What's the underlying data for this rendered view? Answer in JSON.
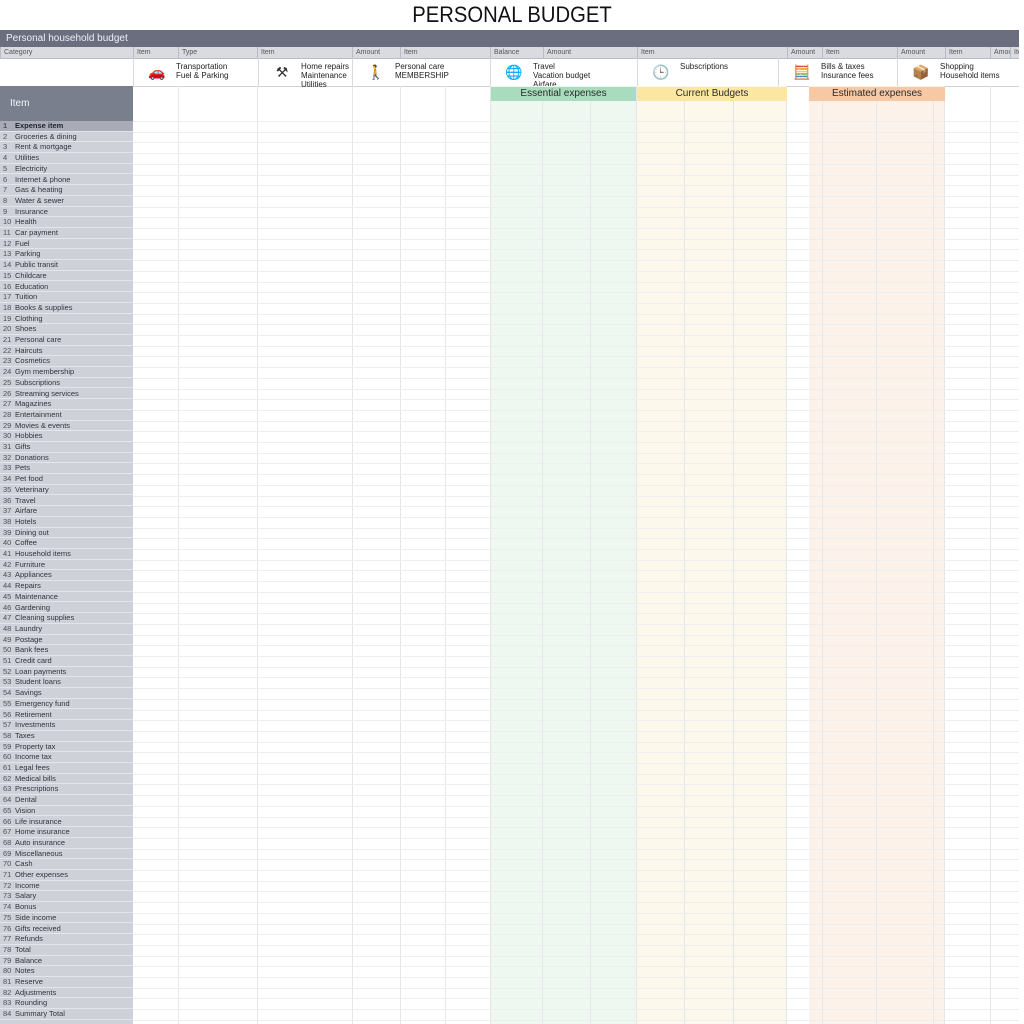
{
  "title": "PERSONAL BUDGET",
  "topbar_label": "Personal household budget",
  "column_headers": [
    "Category",
    "Item",
    "Type",
    "Item",
    "Amount",
    "Item",
    "Balance",
    "Amount",
    "Item",
    "Amount",
    "Item",
    "Amount",
    "Item",
    "Amount",
    "Item"
  ],
  "categories": [
    {
      "icon": "car-icon",
      "glyph": "🚗",
      "label": "Transportation\nFuel & Parking"
    },
    {
      "icon": "tools-icon",
      "glyph": "⚒",
      "label": "Home repairs\nMaintenance\nUtilities"
    },
    {
      "icon": "person-icon",
      "glyph": "🚶",
      "label": "Personal care\nMEMBERSHIP"
    },
    {
      "icon": "globe-icon",
      "glyph": "🌐",
      "label": "Travel\nVacation budget\nAirfare"
    },
    {
      "icon": "clock-icon",
      "glyph": "🕒",
      "label": "Subscriptions"
    },
    {
      "icon": "calculator-icon",
      "glyph": "🧮",
      "label": "Bills & taxes\nInsurance fees"
    },
    {
      "icon": "box-icon",
      "glyph": "📦",
      "label": "Shopping\nHousehold items"
    }
  ],
  "side_header": "Item",
  "sections": {
    "green": "Essential expenses",
    "yellow": "Current Budgets",
    "orange": "Estimated expenses"
  },
  "sidebar_items": [
    "Expense item",
    "Groceries & dining",
    "Rent & mortgage",
    "Utilities",
    "Electricity",
    "Internet & phone",
    "Gas & heating",
    "Water & sewer",
    "Insurance",
    "Health",
    "Car payment",
    "Fuel",
    "Parking",
    "Public transit",
    "Childcare",
    "Education",
    "Tuition",
    "Books & supplies",
    "Clothing",
    "Shoes",
    "Personal care",
    "Haircuts",
    "Cosmetics",
    "Gym membership",
    "Subscriptions",
    "Streaming services",
    "Magazines",
    "Entertainment",
    "Movies & events",
    "Hobbies",
    "Gifts",
    "Donations",
    "Pets",
    "Pet food",
    "Veterinary",
    "Travel",
    "Airfare",
    "Hotels",
    "Dining out",
    "Coffee",
    "Household items",
    "Furniture",
    "Appliances",
    "Repairs",
    "Maintenance",
    "Gardening",
    "Cleaning supplies",
    "Laundry",
    "Postage",
    "Bank fees",
    "Credit card",
    "Loan payments",
    "Student loans",
    "Savings",
    "Emergency fund",
    "Retirement",
    "Investments",
    "Taxes",
    "Property tax",
    "Income tax",
    "Legal fees",
    "Medical bills",
    "Prescriptions",
    "Dental",
    "Vision",
    "Life insurance",
    "Home insurance",
    "Auto insurance",
    "Miscellaneous",
    "Cash",
    "Other expenses",
    "Income",
    "Salary",
    "Bonus",
    "Side income",
    "Gifts received",
    "Refunds",
    "Total",
    "Balance",
    "Notes",
    "Reserve",
    "Adjustments",
    "Rounding",
    "Summary Total"
  ]
}
